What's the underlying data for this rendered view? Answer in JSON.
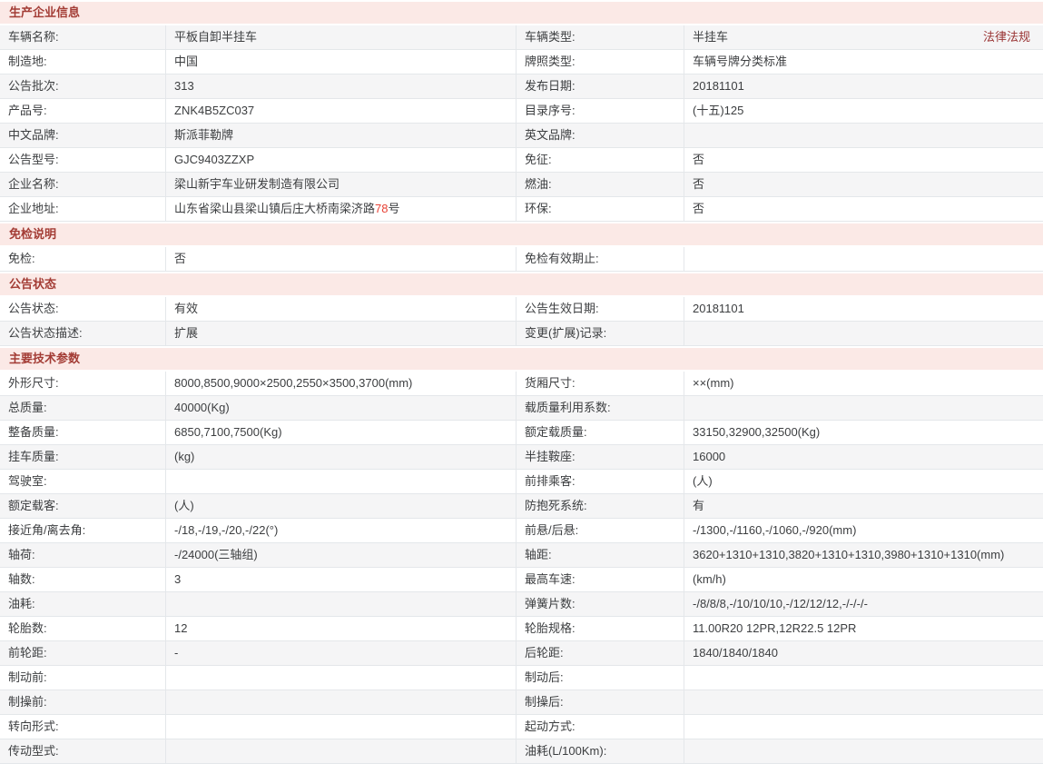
{
  "colors": {
    "section_header_bg": "#fbe9e6",
    "section_header_text": "#a33c35",
    "law_link": "#993333",
    "highlight": "#e84135",
    "stripe": "#f5f5f6",
    "border": "#e4e7ea",
    "text": "#3c3e40"
  },
  "sections": [
    {
      "title": "生产企业信息",
      "rows": [
        {
          "l1": "车辆名称:",
          "v1": "平板自卸半挂车",
          "l2": "车辆类型:",
          "v2": "半挂车",
          "law": "法律法规"
        },
        {
          "l1": "制造地:",
          "v1": "中国",
          "l2": "牌照类型:",
          "v2": "车辆号牌分类标准"
        },
        {
          "l1": "公告批次:",
          "v1": "313",
          "l2": "发布日期:",
          "v2": "20181101"
        },
        {
          "l1": "产品号:",
          "v1": "ZNK4B5ZC037",
          "l2": "目录序号:",
          "v2": "(十五)125"
        },
        {
          "l1": "中文品牌:",
          "v1": "斯派菲勒牌",
          "l2": "英文品牌:",
          "v2": ""
        },
        {
          "l1": "公告型号:",
          "v1": "GJC9403ZZXP",
          "l2": "免征:",
          "v2": "否"
        },
        {
          "l1": "企业名称:",
          "v1": "梁山新宇车业研发制造有限公司",
          "l2": "燃油:",
          "v2": "否"
        },
        {
          "l1": "企业地址:",
          "v1_pre": "山东省梁山县梁山镇后庄大桥南梁济路",
          "v1_hl": "78",
          "v1_post": "号",
          "l2": "环保:",
          "v2": "否"
        }
      ]
    },
    {
      "title": "免检说明",
      "rows": [
        {
          "l1": "免检:",
          "v1": "否",
          "l2": "免检有效期止:",
          "v2": ""
        }
      ]
    },
    {
      "title": "公告状态",
      "rows": [
        {
          "l1": "公告状态:",
          "v1": "有效",
          "l2": "公告生效日期:",
          "v2": "20181101"
        },
        {
          "l1": "公告状态描述:",
          "v1": "扩展",
          "l2": "变更(扩展)记录:",
          "v2": ""
        }
      ]
    },
    {
      "title": "主要技术参数",
      "rows": [
        {
          "l1": "外形尺寸:",
          "v1": "8000,8500,9000×2500,2550×3500,3700(mm)",
          "l2": "货厢尺寸:",
          "v2": "××(mm)"
        },
        {
          "l1": "总质量:",
          "v1": "40000(Kg)",
          "l2": "载质量利用系数:",
          "v2": ""
        },
        {
          "l1": "整备质量:",
          "v1": "6850,7100,7500(Kg)",
          "l2": "额定载质量:",
          "v2": "33150,32900,32500(Kg)"
        },
        {
          "l1": "挂车质量:",
          "v1": "(kg)",
          "l2": "半挂鞍座:",
          "v2": "16000"
        },
        {
          "l1": "驾驶室:",
          "v1": "",
          "l2": "前排乘客:",
          "v2": "(人)"
        },
        {
          "l1": "额定载客:",
          "v1": "(人)",
          "l2": "防抱死系统:",
          "v2": "有"
        },
        {
          "l1": "接近角/离去角:",
          "v1": "-/18,-/19,-/20,-/22(°)",
          "l2": "前悬/后悬:",
          "v2": "-/1300,-/1160,-/1060,-/920(mm)"
        },
        {
          "l1": "轴荷:",
          "v1": "-/24000(三轴组)",
          "l2": "轴距:",
          "v2": "3620+1310+1310,3820+1310+1310,3980+1310+1310(mm)"
        },
        {
          "l1": "轴数:",
          "v1": "3",
          "l2": "最高车速:",
          "v2": "(km/h)"
        },
        {
          "l1": "油耗:",
          "v1": "",
          "l2": "弹簧片数:",
          "v2": "-/8/8/8,-/10/10/10,-/12/12/12,-/-/-/-"
        },
        {
          "l1": "轮胎数:",
          "v1": "12",
          "l2": "轮胎规格:",
          "v2": "11.00R20 12PR,12R22.5 12PR"
        },
        {
          "l1": "前轮距:",
          "v1": "-",
          "l2": "后轮距:",
          "v2": "1840/1840/1840"
        },
        {
          "l1": "制动前:",
          "v1": "",
          "l2": "制动后:",
          "v2": ""
        },
        {
          "l1": "制操前:",
          "v1": "",
          "l2": "制操后:",
          "v2": ""
        },
        {
          "l1": "转向形式:",
          "v1": "",
          "l2": "起动方式:",
          "v2": ""
        },
        {
          "l1": "传动型式:",
          "v1": "",
          "l2": "油耗(L/100Km):",
          "v2": ""
        }
      ]
    }
  ]
}
